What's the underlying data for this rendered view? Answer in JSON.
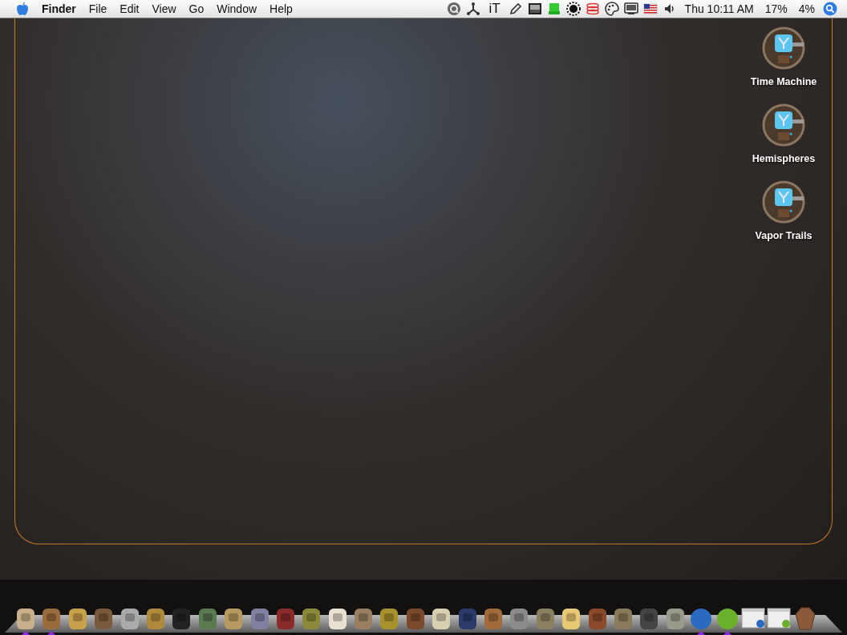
{
  "menu_bar": {
    "app_name": "Finder",
    "menus": [
      "File",
      "Edit",
      "View",
      "Go",
      "Window",
      "Help"
    ],
    "status_items": [
      {
        "kind": "icon"
      },
      {
        "kind": "icon"
      },
      {
        "kind": "text",
        "text": "iT"
      },
      {
        "kind": "icon"
      },
      {
        "kind": "icon"
      },
      {
        "kind": "icon"
      },
      {
        "kind": "icon"
      },
      {
        "kind": "icon"
      },
      {
        "kind": "icon"
      },
      {
        "kind": "icon"
      },
      {
        "kind": "icon"
      },
      {
        "kind": "icon"
      }
    ],
    "clock": "Thu 10:11 AM",
    "readings": [
      "17%",
      "4%"
    ]
  },
  "desktop_icons": [
    {
      "label": "Time Machine"
    },
    {
      "label": "Hemispheres"
    },
    {
      "label": "Vapor Trails"
    }
  ],
  "dock": {
    "items": [
      {
        "running": true
      },
      {
        "running": true
      },
      {
        "running": false
      },
      {
        "running": false
      },
      {
        "running": false
      },
      {
        "running": false
      },
      {
        "running": false
      },
      {
        "running": false
      },
      {
        "running": false
      },
      {
        "running": false
      },
      {
        "running": false
      },
      {
        "running": false
      },
      {
        "running": false
      },
      {
        "running": false
      },
      {
        "running": false
      },
      {
        "running": false
      },
      {
        "running": false
      },
      {
        "running": false
      },
      {
        "running": false
      },
      {
        "running": false
      },
      {
        "running": false
      },
      {
        "running": false
      },
      {
        "running": false
      },
      {
        "running": false
      },
      {
        "running": false
      },
      {
        "running": false
      },
      {
        "running": true
      },
      {
        "running": true
      }
    ]
  }
}
